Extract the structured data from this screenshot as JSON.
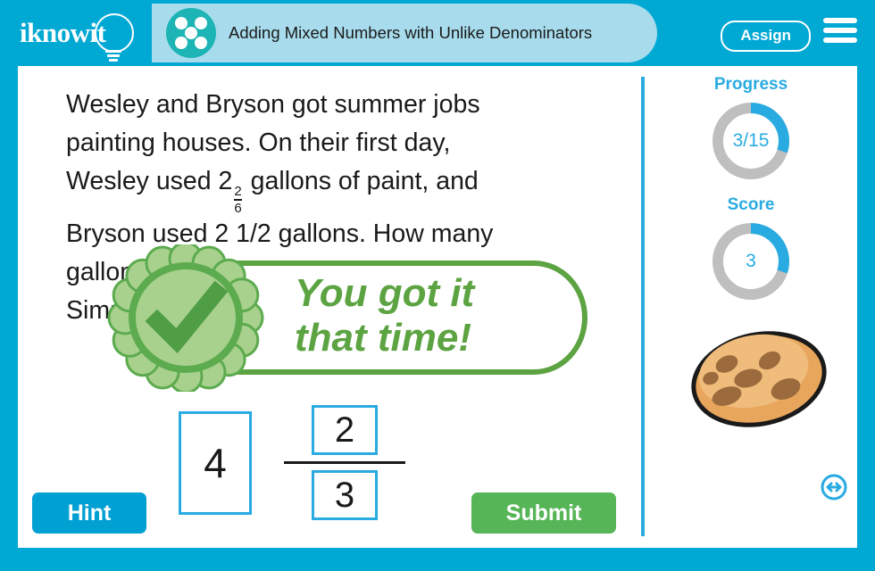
{
  "header": {
    "logo_text": "iknowit",
    "logo_icon": "lightbulb-icon",
    "lesson_icon": "dice-five-icon",
    "title": "Adding Mixed Numbers with Unlike Denominators",
    "assign_label": "Assign",
    "menu_icon": "hamburger-menu-icon"
  },
  "question": {
    "line1": "Wesley and Bryson got summer jobs",
    "line2": "painting houses. On their first day,",
    "line3_pre": "Wesley used 2",
    "line3_frac_num": "2",
    "line3_frac_den": "6",
    "line3_post": "gallons of paint, and",
    "line4": "Bryson used 2 1/2 gallons. How many",
    "line5": "gallons of paint did they use in all?",
    "line6": "Simplify your answer."
  },
  "answer": {
    "whole": "4",
    "numerator": "2",
    "denominator": "3"
  },
  "buttons": {
    "hint": "Hint",
    "submit": "Submit"
  },
  "panel": {
    "progress_label": "Progress",
    "progress_value": "3/15",
    "progress_percent": 30,
    "score_label": "Score",
    "score_value": "3",
    "score_percent": 30,
    "reward_icon": "cookie-icon",
    "resize_icon": "resize-horizontal-icon"
  },
  "feedback": {
    "line1": "You got it",
    "line2": "that time!",
    "seal_icon": "checkmark-seal-icon"
  },
  "colors": {
    "frame_blue": "#00a8d4",
    "accent_blue": "#29abe2",
    "title_pill": "#a8dced",
    "dice_teal": "#1cb4b4",
    "submit_green": "#56b556",
    "feedback_green": "#5ca342",
    "seal_light": "#a9d18e",
    "donut_track": "#bfbfbf"
  }
}
